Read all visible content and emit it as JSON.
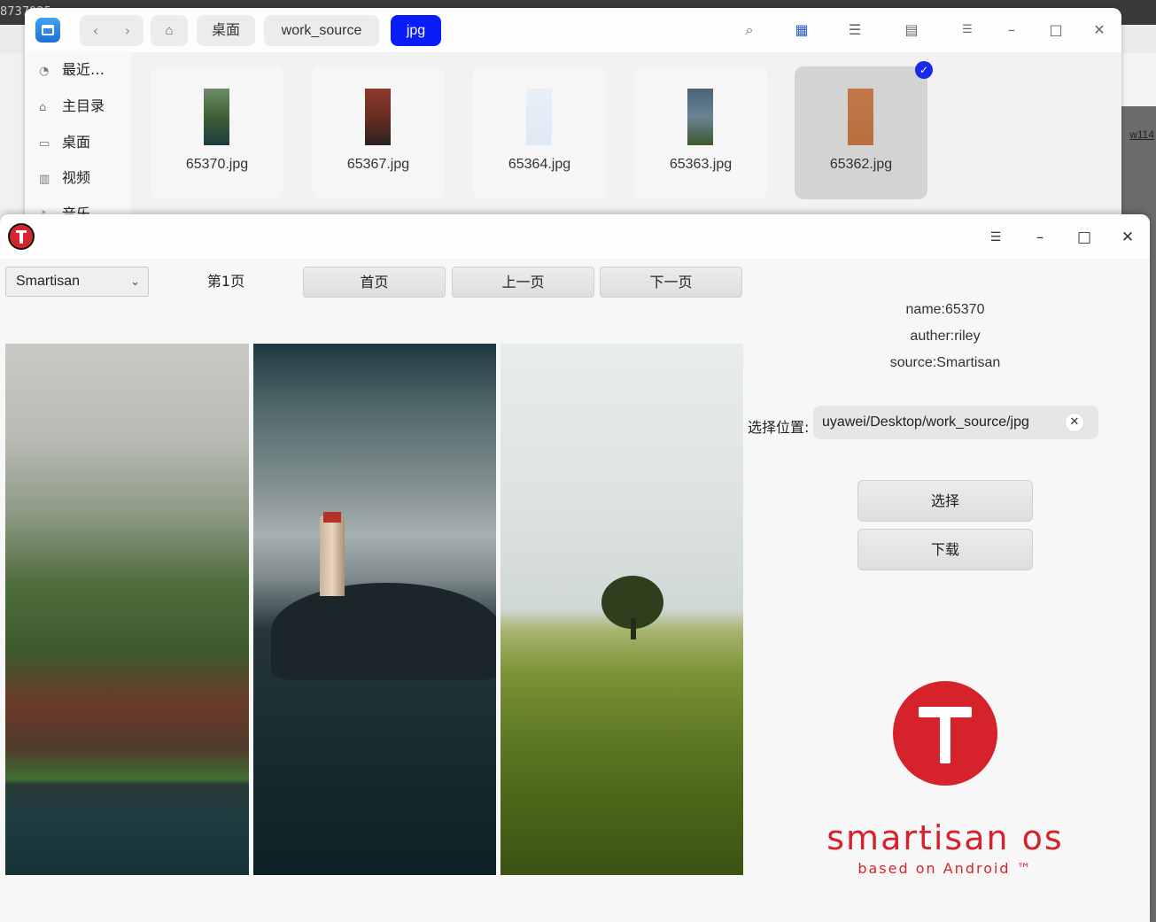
{
  "background": {
    "browser_tab_text": "8737925",
    "right_link": "w114"
  },
  "file_manager": {
    "nav": {
      "back_icon": "chevron-left-icon",
      "forward_icon": "chevron-right-icon"
    },
    "breadcrumbs": [
      "桌面",
      "work_source",
      "jpg"
    ],
    "sidebar": [
      {
        "icon": "clock-icon",
        "label": "最近…"
      },
      {
        "icon": "home-icon",
        "label": "主目录"
      },
      {
        "icon": "desktop-icon",
        "label": "桌面"
      },
      {
        "icon": "video-icon",
        "label": "视频"
      },
      {
        "icon": "music-icon",
        "label": "音乐"
      }
    ],
    "files": [
      {
        "name": "65370.jpg",
        "thumb_color": "#3f6034"
      },
      {
        "name": "65367.jpg",
        "thumb_color": "#6a2e22"
      },
      {
        "name": "65364.jpg",
        "thumb_color": "#dfe9f4"
      },
      {
        "name": "65363.jpg",
        "thumb_color": "#4a6477"
      },
      {
        "name": "65362.jpg",
        "thumb_color": "#c0784a",
        "selected": true
      }
    ]
  },
  "app": {
    "source_select": {
      "value": "Smartisan"
    },
    "page_label": "第1页",
    "buttons": {
      "first": "首页",
      "prev": "上一页",
      "next": "下一页"
    },
    "info": {
      "name": "name:65370",
      "author": "auther:riley",
      "source": "source:Smartisan"
    },
    "location_label": "选择位置:",
    "location_value": "uyawei/Desktop/work_source/jpg",
    "select_button": "选择",
    "download_button": "下载",
    "brand": "smartisan os",
    "brand_sub": "based on Android ™"
  },
  "colors": {
    "accent": "#0a1cf7",
    "brand_red": "#d6232b"
  }
}
